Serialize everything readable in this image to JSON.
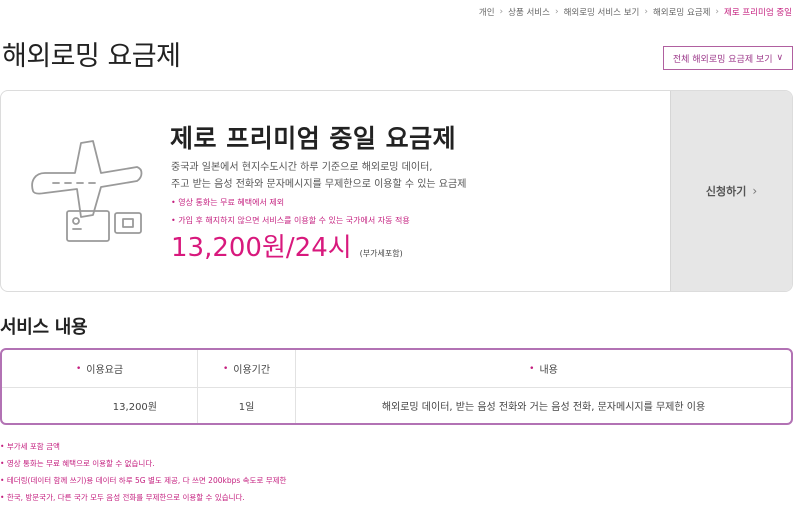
{
  "breadcrumb": [
    {
      "label": "개인"
    },
    {
      "label": "상품 서비스"
    },
    {
      "label": "해외로밍 서비스 보기"
    },
    {
      "label": "해외로밍 요금제"
    },
    {
      "label": "제로 프리미엄 중일",
      "current": true
    }
  ],
  "page": {
    "title": "해외로밍 요금제"
  },
  "view_all": {
    "label": "전체 해외로밍 요금제 보기"
  },
  "plan": {
    "name": "제로 프리미엄 중일 요금제",
    "desc_line1": "중국과 일본에서 현지수도시간 하루 기준으로 해외로밍 데이터,",
    "desc_line2": "주고 받는 음성 전화와 문자메시지를 무제한으로 이용할 수 있는 요금제",
    "note1": "• 영상 통화는 무료 혜택에서 제외",
    "note2": "• 가입 후 해지하지 않으면 서비스를 이용할 수 있는 국가에서 자동 적용",
    "price": "13,200원/24시",
    "vat": "(부가세포함)",
    "apply_label": "신청하기"
  },
  "service": {
    "title": "서비스 내용",
    "headers": [
      "이용요금",
      "이용기간",
      "내용"
    ],
    "rows": [
      {
        "fee": "13,200원",
        "period": "1일",
        "content": "해외로밍 데이터, 받는 음성 전화와 거는 음성 전화, 문자메시지를 무제한 이용"
      }
    ]
  },
  "notes": [
    "부가세 포함 금액",
    "영상 통화는 무료 혜택으로 이용할 수 없습니다.",
    "테더링(데이터 함께 쓰기)용 데이터 하루 5G 별도 제공, 다 쓰면 200kbps 속도로 무제한",
    "한국, 방문국가, 다른 국가 모두 음성 전화를 무제한으로 이용할 수 있습니다."
  ],
  "colors": {
    "accent": "#c41f7f",
    "border": "#b272b4",
    "apply_bg": "#e6e6e6"
  },
  "icons": {
    "plan": "airplane-with-ticket-icon",
    "chevron": "chevron-right-icon"
  }
}
